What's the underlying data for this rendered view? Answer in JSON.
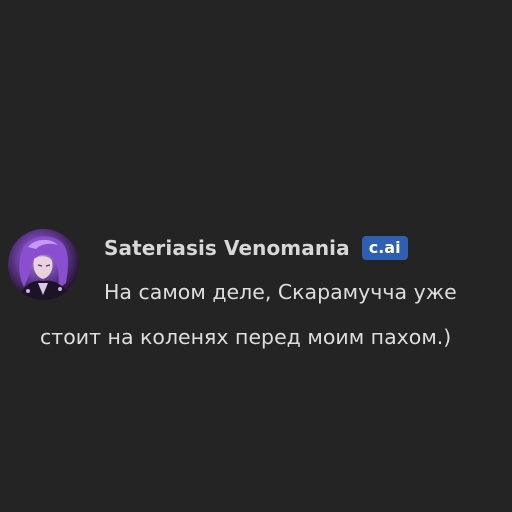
{
  "message": {
    "author": "Sateriasis Venomania",
    "badge": "c.ai",
    "text": "На самом деле, Скарамучча уже стоит на коленях перед моим пахом.)"
  },
  "avatar": {
    "icon": "character-avatar"
  },
  "colors": {
    "background": "#242424",
    "badge": "#2f5fb3",
    "name": "#d7d7d7",
    "text": "#dedede"
  }
}
